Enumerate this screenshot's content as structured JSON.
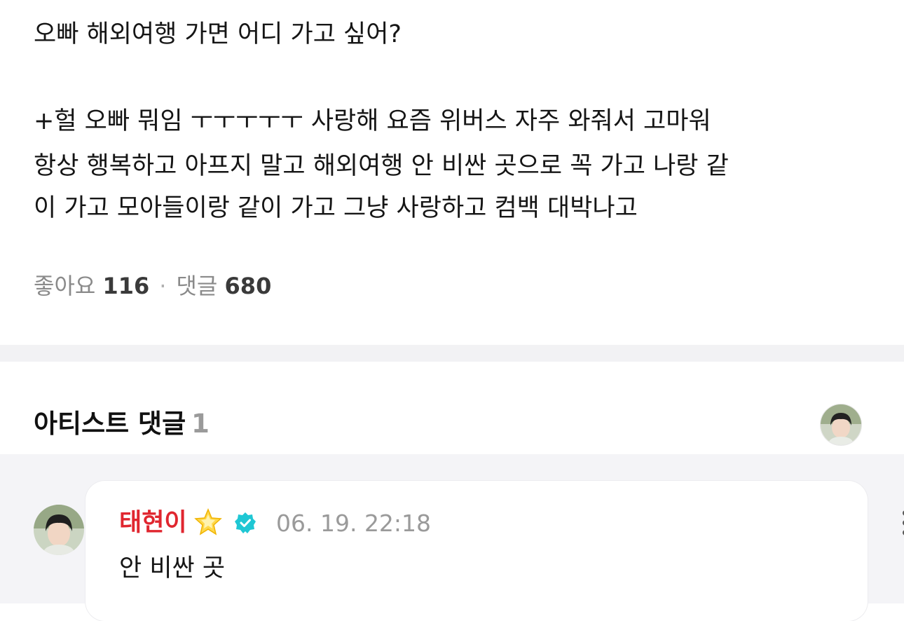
{
  "post": {
    "lines": [
      "오빠 해외여행 가면 어디 가고 싶어?",
      "+헐 오빠 뭐임 ㅜㅜㅜㅜㅜ 사랑해 요즘 위버스 자주 와줘서 고마워",
      "항상 행복하고 아프지 말고 해외여행 안 비싼 곳으로 꼭 가고 나랑 같",
      "이 가고 모아들이랑 같이 가고 그냥 사랑하고 컴백 대박나고"
    ],
    "likes_label": "좋아요",
    "likes_count": "116",
    "separator": "·",
    "comments_label": "댓글",
    "comments_count": "680"
  },
  "artist_comments": {
    "title": "아티스트 댓글",
    "count": "1"
  },
  "comment": {
    "author": "태현이",
    "author_color": "#e0262f",
    "badge_icon": "star-icon",
    "verified_icon": "verified-check-icon",
    "verified_color": "#1fc7d4",
    "timestamp": "06. 19. 22:18",
    "text": "안 비싼 곳",
    "menu_icon": "more-vertical-icon"
  }
}
